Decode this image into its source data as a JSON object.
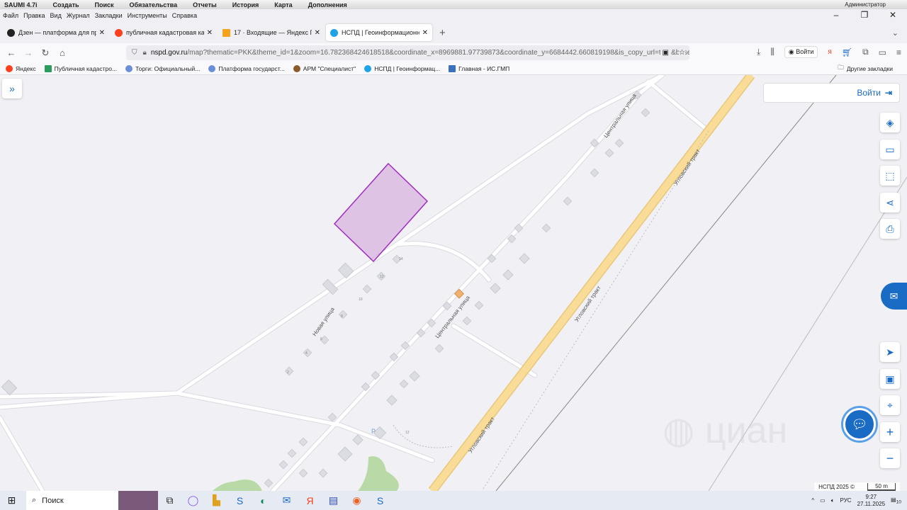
{
  "appbar": {
    "items": [
      "SAUMI 4.7i",
      "Создать",
      "Поиск",
      "Обязательства",
      "Отчеты",
      "История",
      "Карта",
      "Дополнения"
    ],
    "user": "Администратор"
  },
  "menubar": {
    "items": [
      "Файл",
      "Правка",
      "Вид",
      "Журнал",
      "Закладки",
      "Инструменты",
      "Справка"
    ]
  },
  "tabs": [
    {
      "label": "Дзен — платформа для просм",
      "color": "#222"
    },
    {
      "label": "публичная кадастровая карта",
      "color": "#fc3f1d"
    },
    {
      "label": "17 · Входящие — Яндекс Почта",
      "color": "#f7a21b"
    },
    {
      "label": "НСПД | Геоинформационный",
      "color": "#1fa3e8",
      "active": true
    }
  ],
  "url": {
    "host": "nspd.gov.ru",
    "rest": "/map?thematic=PKK&theme_id=1&zoom=16.782368424618518&coordinate_x=8969881.97739873&coordinate_y=6684442.660819198&is_copy_url=true&baseLay"
  },
  "toolbar": {
    "login": "Войти"
  },
  "bookmarks": [
    {
      "label": "Яндекс",
      "color": "#fc3f1d"
    },
    {
      "label": "Публичная кадастро...",
      "color": "#2a9d5c"
    },
    {
      "label": "Торги: Официальный...",
      "color": "#6a8fd8"
    },
    {
      "label": "Платформа государст...",
      "color": "#6a8fd8"
    },
    {
      "label": "АРМ \"Специалист\"",
      "color": "#8a5a2a"
    },
    {
      "label": "НСПД | Геоинформац...",
      "color": "#1fa3e8"
    },
    {
      "label": "Главная - ИС.ГМП",
      "color": "#3a70c0"
    }
  ],
  "other_bookmarks": "Другие закладки",
  "map": {
    "login": "Войти",
    "streets": {
      "novaya": "Новая улица",
      "central1": "Центральная улица",
      "central2": "Центральная улица",
      "trakt1": "Угловский тракт",
      "trakt2": "Угловский тракт",
      "trakt3": "Угловский тракт"
    },
    "house_numbers": [
      "14",
      "12",
      "10",
      "8",
      "6",
      "4",
      "2",
      "12"
    ],
    "parking": "P",
    "attribution": "НСПД 2025 ©",
    "scale": "50 m",
    "watermark": "циан",
    "parcel_color": "#a02ec0",
    "road_color": "#f9dc98"
  },
  "taskbar": {
    "search": "Поиск",
    "lang": "РУС",
    "time": "9:27",
    "date": "27.11.2025",
    "notifications": "10"
  }
}
